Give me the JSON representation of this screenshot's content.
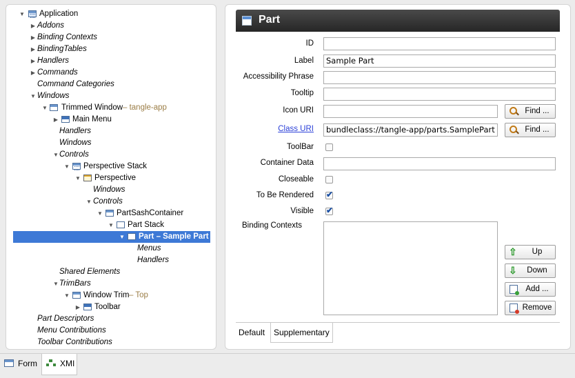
{
  "tree": {
    "items": [
      {
        "label": "Application",
        "italic": false,
        "expanded": true,
        "icon": "app-icon"
      },
      {
        "label": "Addons",
        "italic": true,
        "expanded": false
      },
      {
        "label": "Binding Contexts",
        "italic": true,
        "expanded": false
      },
      {
        "label": "BindingTables",
        "italic": true,
        "expanded": false
      },
      {
        "label": "Handlers",
        "italic": true,
        "expanded": false
      },
      {
        "label": "Commands",
        "italic": true,
        "expanded": false
      },
      {
        "label": "Command Categories",
        "italic": true
      },
      {
        "label": "Windows",
        "italic": true,
        "expanded": true
      },
      {
        "label": "Trimmed Window",
        "extra": " – tangle-app",
        "italic": false,
        "expanded": true,
        "icon": "window-icon"
      },
      {
        "label": "Main Menu",
        "italic": false,
        "expanded": false,
        "icon": "menu-icon"
      },
      {
        "label": "Handlers",
        "italic": true
      },
      {
        "label": "Windows",
        "italic": true
      },
      {
        "label": "Controls",
        "italic": true,
        "expanded": true
      },
      {
        "label": "Perspective Stack",
        "italic": false,
        "expanded": true,
        "icon": "perspective-stack-icon"
      },
      {
        "label": "Perspective",
        "italic": false,
        "expanded": true,
        "icon": "perspective-icon"
      },
      {
        "label": "Windows",
        "italic": true
      },
      {
        "label": "Controls",
        "italic": true,
        "expanded": true
      },
      {
        "label": "PartSashContainer",
        "italic": false,
        "expanded": true,
        "icon": "sash-container-icon"
      },
      {
        "label": "Part Stack",
        "italic": false,
        "expanded": true,
        "icon": "part-stack-icon"
      },
      {
        "label": "Part – Sample Part",
        "italic": false,
        "expanded": true,
        "icon": "part-icon",
        "selected": true
      },
      {
        "label": "Menus",
        "italic": true
      },
      {
        "label": "Handlers",
        "italic": true
      },
      {
        "label": "Shared Elements",
        "italic": true
      },
      {
        "label": "TrimBars",
        "italic": true,
        "expanded": true
      },
      {
        "label": "Window Trim",
        "extra": " – Top",
        "italic": false,
        "expanded": true,
        "icon": "window-trim-icon"
      },
      {
        "label": "Toolbar",
        "italic": false,
        "expanded": false,
        "icon": "toolbar-icon"
      },
      {
        "label": "Part Descriptors",
        "italic": true
      },
      {
        "label": "Menu Contributions",
        "italic": true
      },
      {
        "label": "Toolbar Contributions",
        "italic": true
      }
    ]
  },
  "form": {
    "title": "Part",
    "fields": {
      "id": {
        "label": "ID",
        "value": ""
      },
      "label": {
        "label": "Label",
        "value": "Sample Part"
      },
      "accessibility": {
        "label": "Accessibility Phrase",
        "value": ""
      },
      "tooltip": {
        "label": "Tooltip",
        "value": ""
      },
      "icon_uri": {
        "label": "Icon URI",
        "value": ""
      },
      "class_uri": {
        "label": "Class URI",
        "value": "bundleclass://tangle-app/parts.SamplePart"
      },
      "toolbar": {
        "label": "ToolBar",
        "checked": false
      },
      "container_data": {
        "label": "Container Data",
        "value": ""
      },
      "closeable": {
        "label": "Closeable",
        "checked": false
      },
      "to_be_rendered": {
        "label": "To Be Rendered",
        "checked": true
      },
      "visible": {
        "label": "Visible",
        "checked": true
      },
      "binding_contexts": {
        "label": "Binding Contexts"
      }
    },
    "buttons": {
      "find": "Find ...",
      "up": "Up",
      "down": "Down",
      "add": "Add ...",
      "remove": "Remove"
    },
    "tabs": [
      "Default",
      "Supplementary"
    ],
    "active_tab": "Supplementary"
  },
  "bottom_tabs": [
    {
      "label": "Form",
      "icon": "form-icon"
    },
    {
      "label": "XMI",
      "icon": "xmi-icon"
    }
  ],
  "colors": {
    "selection": "#3d79d6",
    "header": "#2f2f2f",
    "link": "#2a3fd8",
    "extra_text": "#9b7d46"
  }
}
